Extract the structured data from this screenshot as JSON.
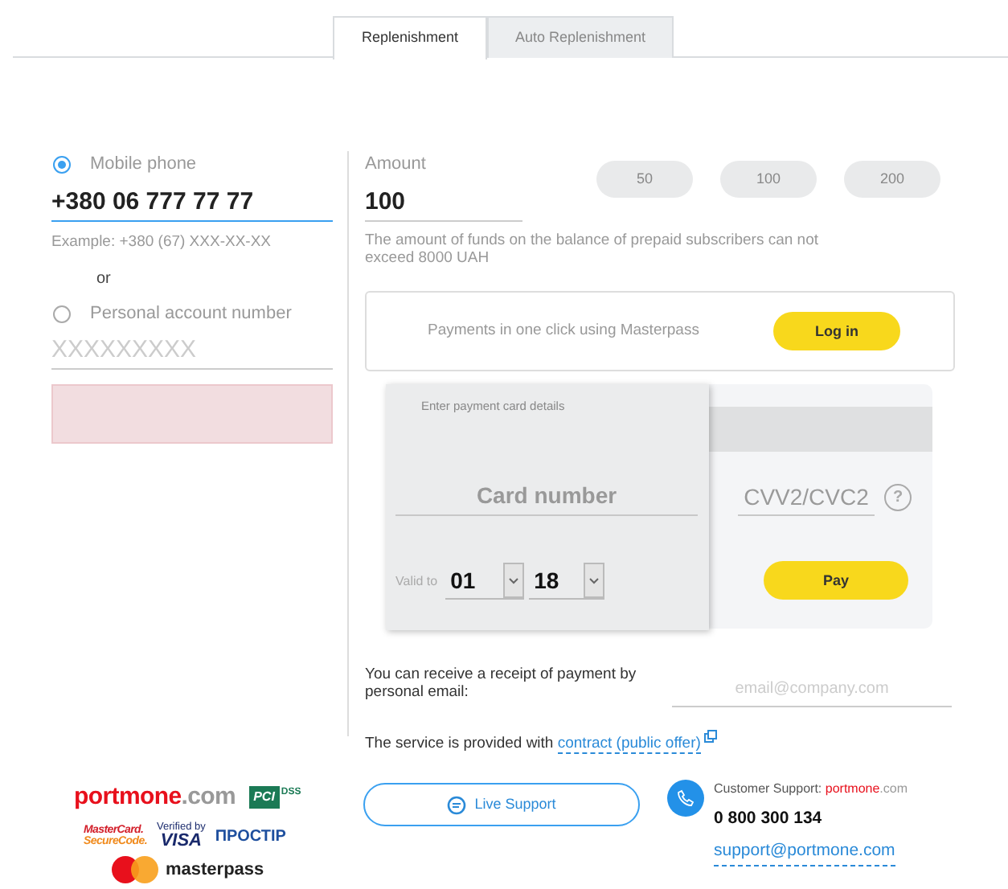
{
  "tabs": [
    {
      "label": "Replenishment",
      "selected": true
    },
    {
      "label": "Auto Replenishment",
      "selected": false
    }
  ],
  "account": {
    "options": [
      {
        "label": "Mobile phone",
        "selected": true,
        "value": "+380 06 777 77 77",
        "hint": "Example: +380 (67) XXX-XX-XX"
      },
      {
        "label": "Personal account number",
        "selected": false,
        "placeholder": "XXXXXXXXX"
      }
    ],
    "separator": "or"
  },
  "amount": {
    "label": "Amount",
    "value": "100",
    "presets": [
      "50",
      "100",
      "200"
    ],
    "note": "The amount of funds on the balance of prepaid subscribers can not exceed 8000 UAH"
  },
  "masterpass": {
    "text": "Payments in one click using Masterpass",
    "button": "Log in"
  },
  "card": {
    "title": "Enter payment card details",
    "number_placeholder": "Card number",
    "valid_label": "Valid to",
    "month": "01",
    "year": "18",
    "cvv_placeholder": "CVV2/CVC2",
    "help": "?",
    "pay": "Pay"
  },
  "receipt": {
    "text": "You can receive a receipt of payment by personal email:",
    "email_placeholder": "email@company.com"
  },
  "service": {
    "text": "The service is provided with",
    "link": "contract (public offer)"
  },
  "footer": {
    "portmone_logo": {
      "name": "portmone",
      "domain": ".com"
    },
    "pci_logo": {
      "main": "PCI",
      "sub": "DSS"
    },
    "securecode_logo": [
      "MasterCard.",
      "SecureCode."
    ],
    "visa_logo": {
      "top": "Verified by",
      "main": "VISA"
    },
    "prostir_logo": "ПРОСТІР",
    "masterpass_logo": "masterpass",
    "live_support": "Live Support",
    "support_label": "Customer Support:",
    "support_brand": {
      "name": "portmone",
      "domain": ".com"
    },
    "phone": "0 800 300 134",
    "email": "support@portmone.com"
  }
}
